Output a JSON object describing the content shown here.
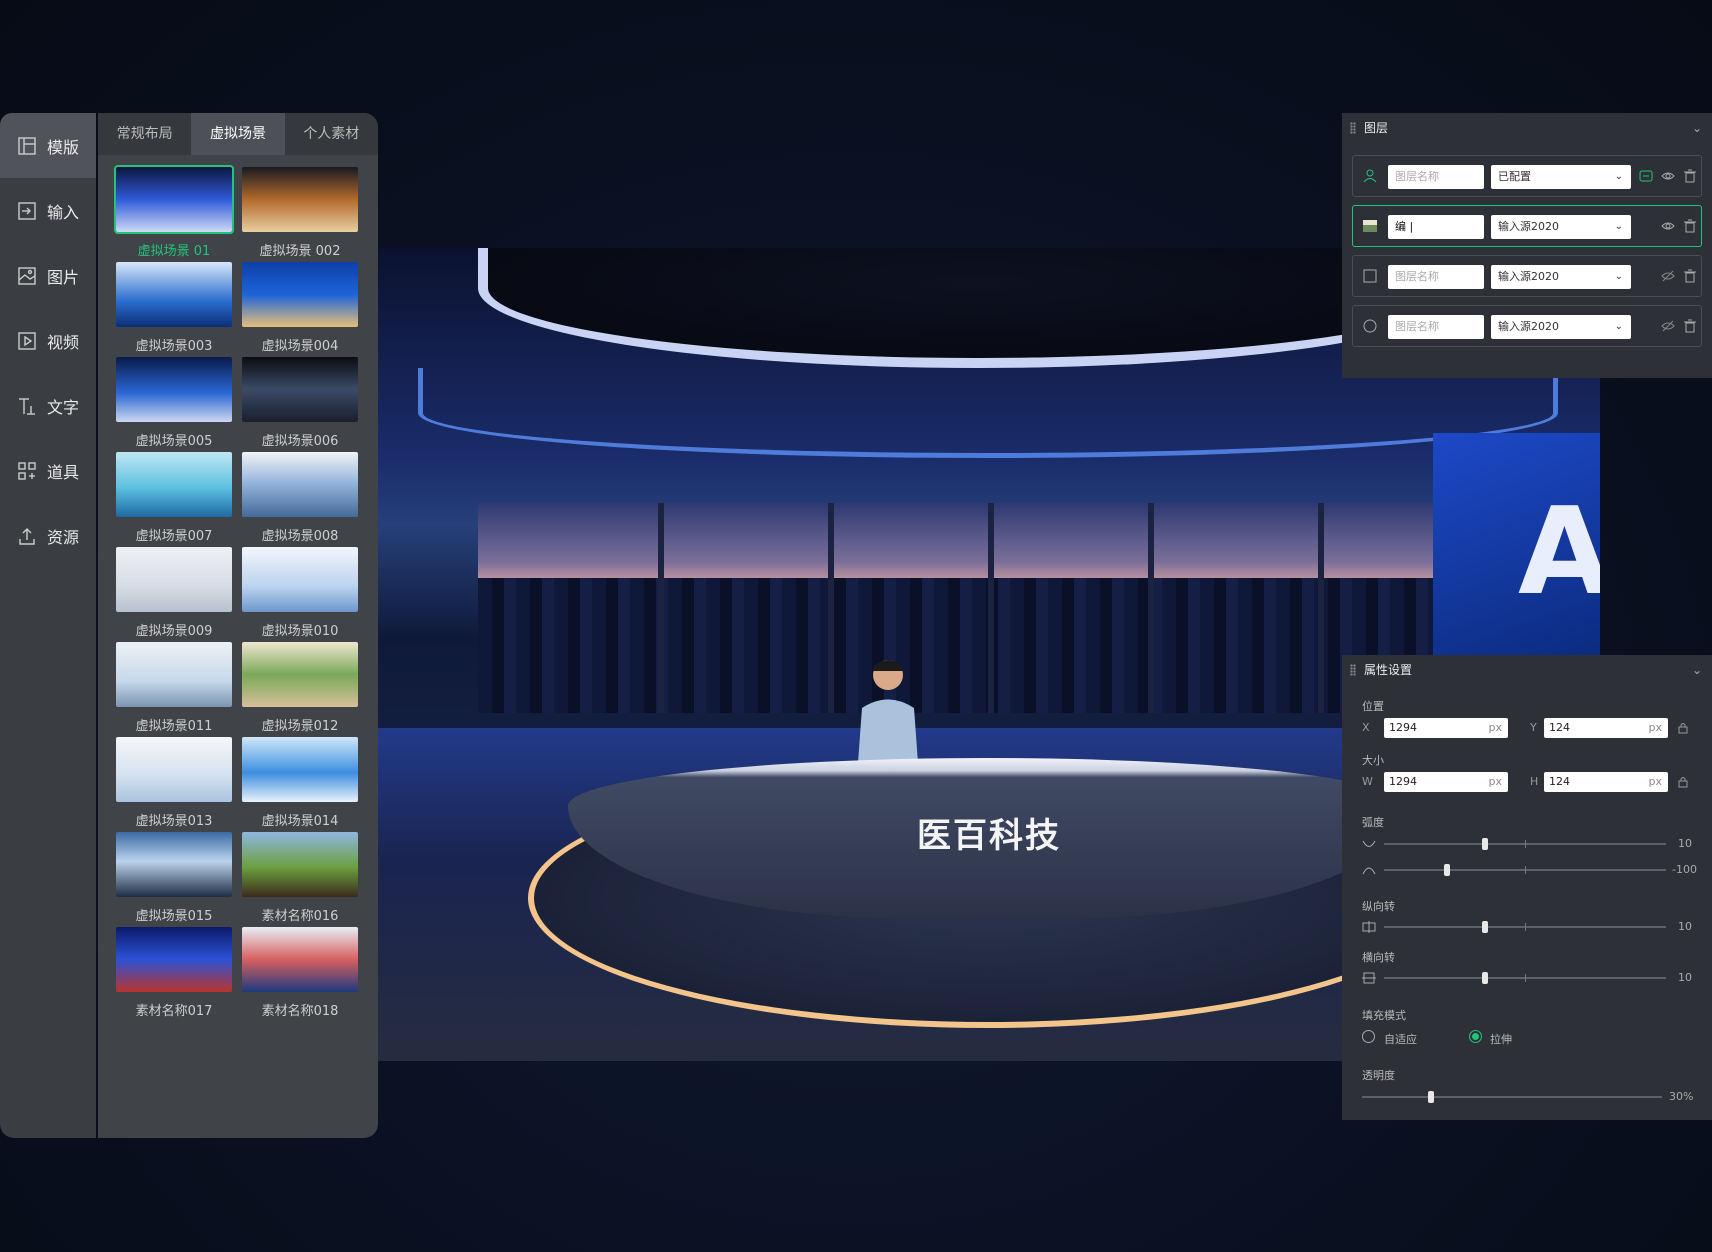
{
  "sidebar": {
    "items": [
      {
        "label": "模版",
        "icon": "template-icon"
      },
      {
        "label": "输入",
        "icon": "input-icon"
      },
      {
        "label": "图片",
        "icon": "image-icon"
      },
      {
        "label": "视频",
        "icon": "video-icon"
      },
      {
        "label": "文字",
        "icon": "text-icon"
      },
      {
        "label": "道具",
        "icon": "props-icon"
      },
      {
        "label": "资源",
        "icon": "upload-icon"
      }
    ]
  },
  "panel": {
    "tabs": [
      {
        "label": "常规布局"
      },
      {
        "label": "虚拟场景"
      },
      {
        "label": "个人素材"
      }
    ],
    "items": [
      {
        "label": "虚拟场景 01"
      },
      {
        "label": "虚拟场景 002"
      },
      {
        "label": "虚拟场景003"
      },
      {
        "label": "虚拟场景004"
      },
      {
        "label": "虚拟场景005"
      },
      {
        "label": "虚拟场景006"
      },
      {
        "label": "虚拟场景007"
      },
      {
        "label": "虚拟场景008"
      },
      {
        "label": "虚拟场景009"
      },
      {
        "label": "虚拟场景010"
      },
      {
        "label": "虚拟场景011"
      },
      {
        "label": "虚拟场景012"
      },
      {
        "label": "虚拟场景013"
      },
      {
        "label": "虚拟场景014"
      },
      {
        "label": "虚拟场景015"
      },
      {
        "label": "素材名称016"
      },
      {
        "label": "素材名称017"
      },
      {
        "label": "素材名称018"
      }
    ]
  },
  "preview": {
    "desk_logo": "医百科技",
    "screen_glyph": "A"
  },
  "layers": {
    "title": "图层",
    "rows": [
      {
        "name_placeholder": "图层名称",
        "name": "",
        "source": "已配置"
      },
      {
        "name_placeholder": "",
        "name": "编 |",
        "source": "输入源2020"
      },
      {
        "name_placeholder": "图层名称",
        "name": "",
        "source": "输入源2020"
      },
      {
        "name_placeholder": "图层名称",
        "name": "",
        "source": "输入源2020"
      }
    ]
  },
  "props": {
    "title": "属性设置",
    "position_label": "位置",
    "size_label": "大小",
    "x_label": "X",
    "y_label": "Y",
    "w_label": "W",
    "h_label": "H",
    "x": "1294",
    "y": "124",
    "w": "1294",
    "h": "124",
    "unit": "px",
    "curve_label": "弧度",
    "vflip_label": "纵向转",
    "hflip_label": "横向转",
    "fill_label": "填充模式",
    "fill_auto": "自适应",
    "fill_stretch": "拉伸",
    "opacity_label": "透明度",
    "curve1_value": "10",
    "curve2_value": "-100",
    "vflip_value": "10",
    "hflip_value": "10",
    "opacity_value": "30%"
  },
  "colors": {
    "accent": "#22c47a"
  }
}
